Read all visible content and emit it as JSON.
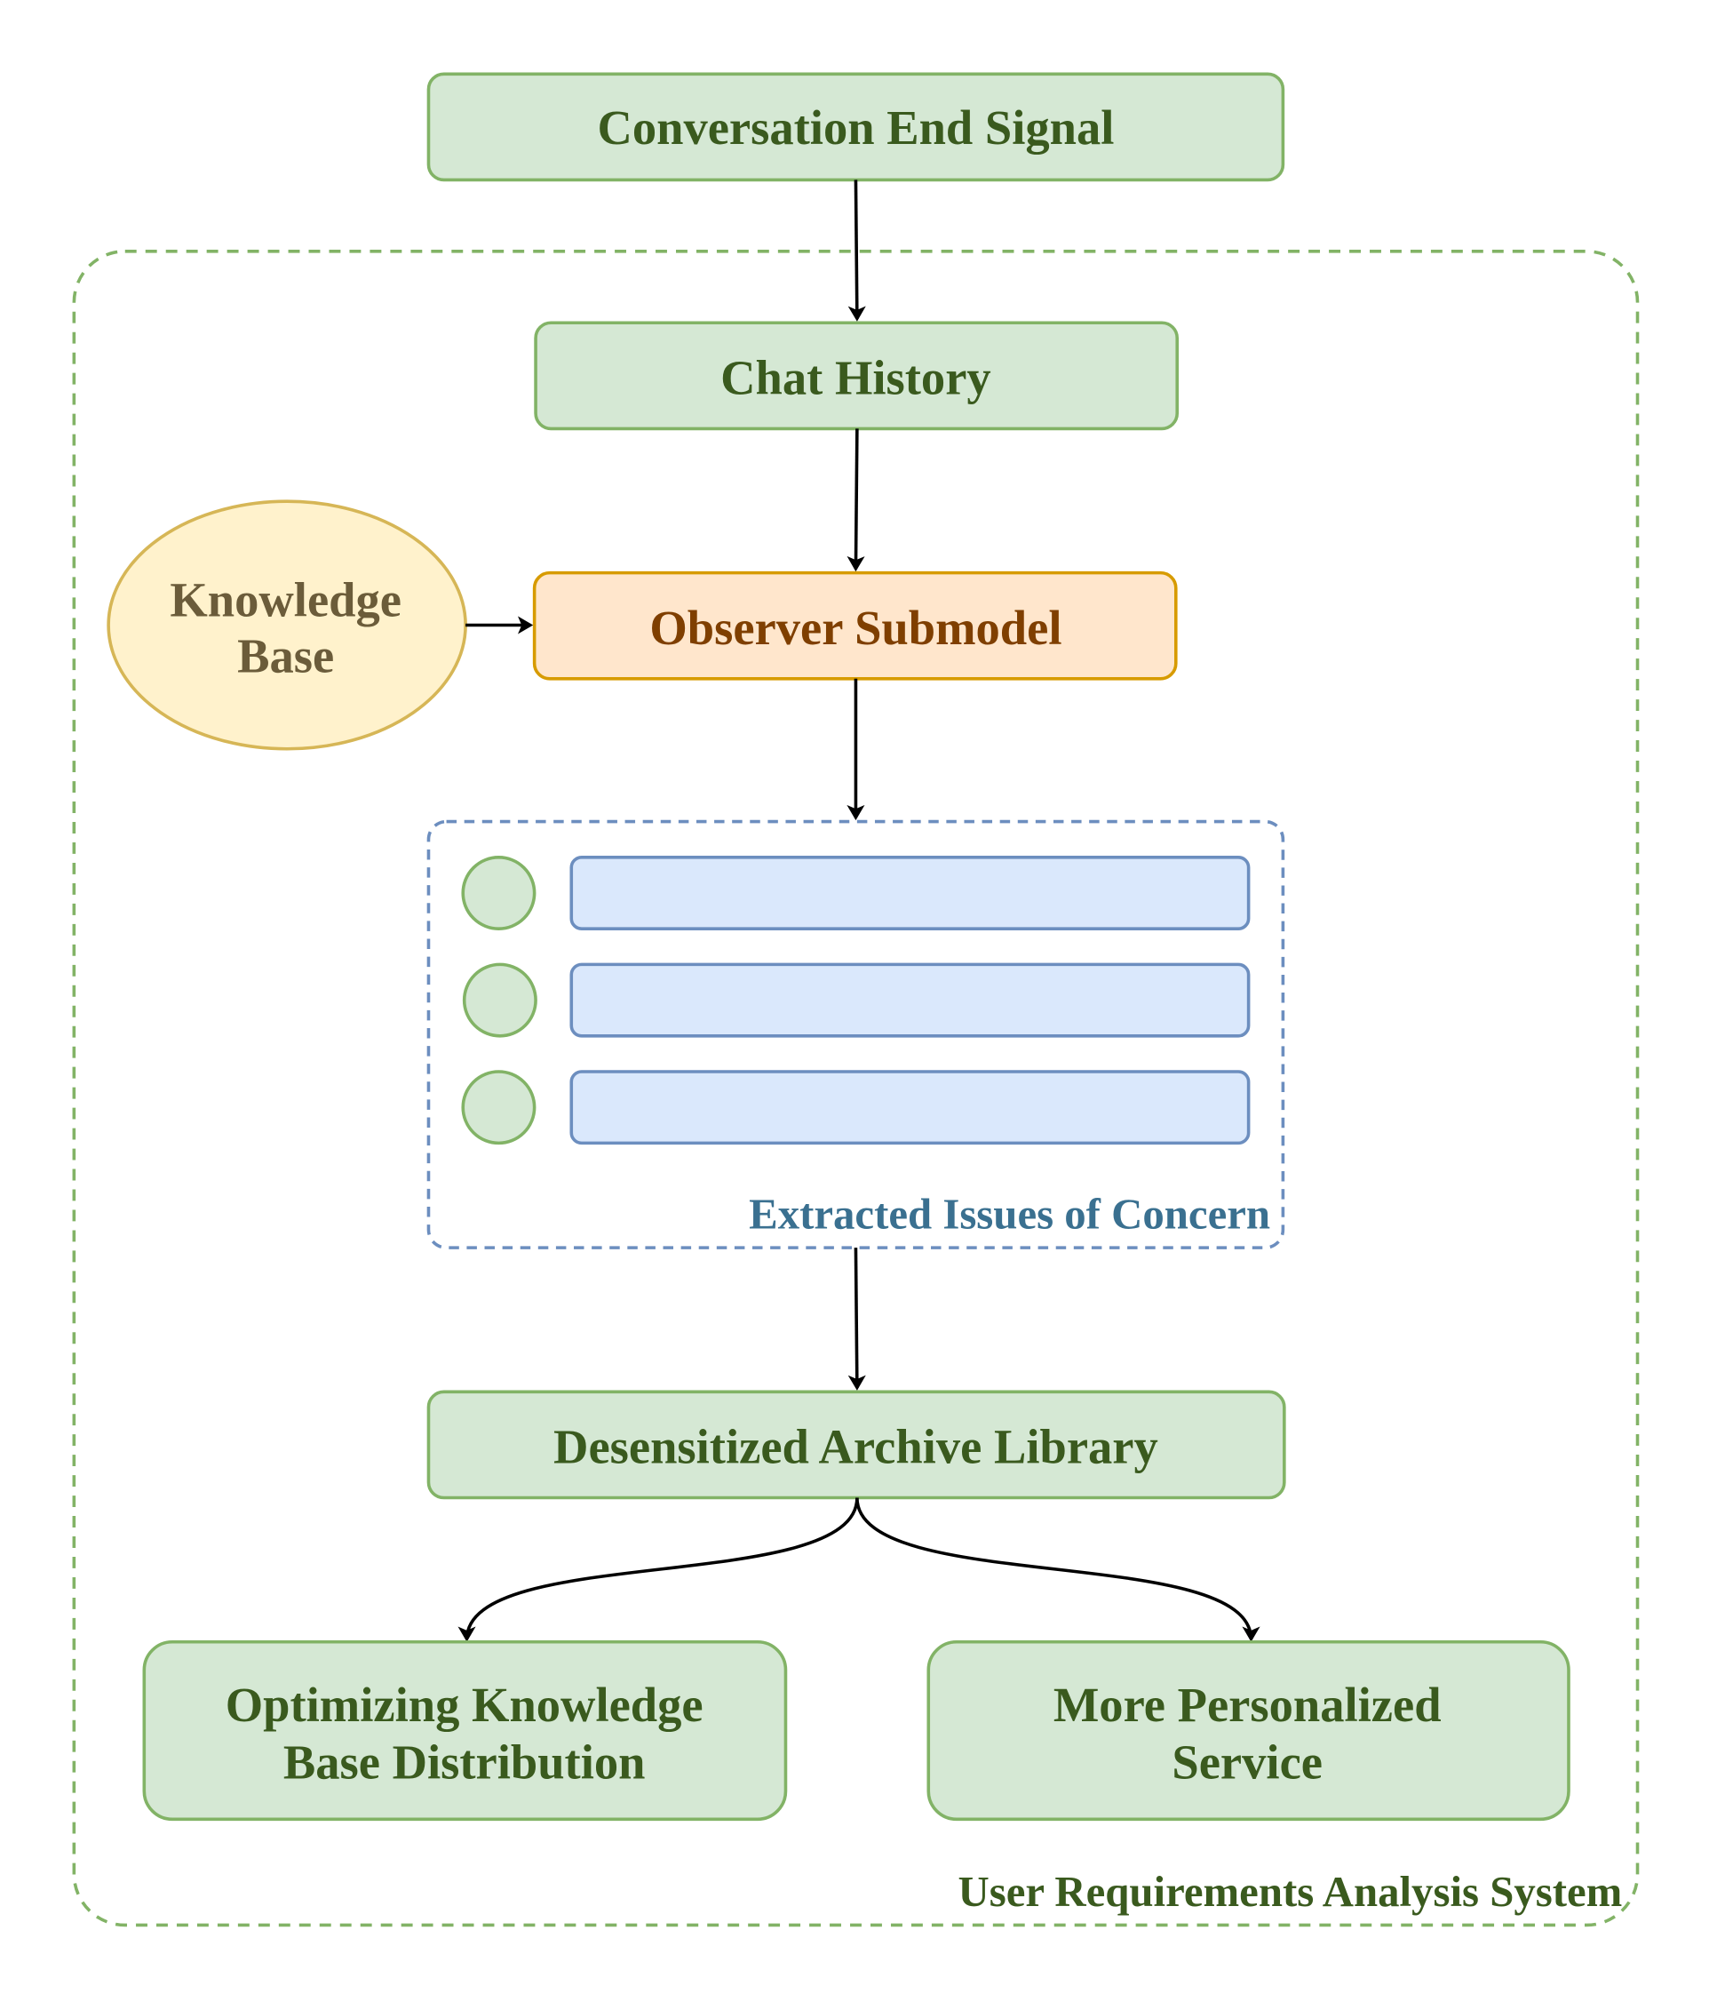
{
  "nodes": {
    "signal": "Conversation End Signal",
    "chat_history": "Chat History",
    "knowledge_base": [
      "Knowledge",
      "Base"
    ],
    "observer": "Observer Submodel",
    "issues_label": "Extracted Issues of Concern",
    "archive": "Desensitized Archive Library",
    "optimizing": [
      "Optimizing Knowledge",
      "Base Distribution"
    ],
    "personalized": [
      "More Personalized",
      "Service"
    ],
    "system_label": "User Requirements Analysis System"
  },
  "colors": {
    "green_fill": "#d5e8d4",
    "green_stroke": "#82b366",
    "orange_fill": "#ffe6cc",
    "orange_stroke": "#d79b00",
    "yellow_fill": "#fff2cc",
    "yellow_stroke": "#d6b656",
    "blue_fill": "#dae8fc",
    "blue_stroke": "#6c8ebf"
  }
}
